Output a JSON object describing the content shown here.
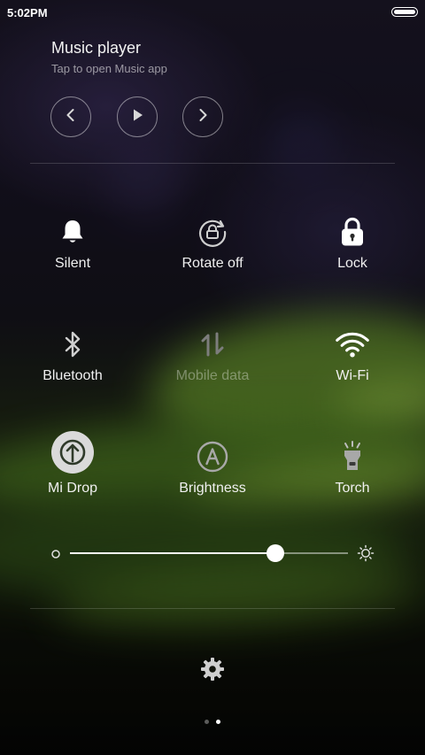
{
  "status_bar": {
    "time": "5:02PM",
    "battery_level": 1.0
  },
  "music": {
    "title": "Music player",
    "subtitle": "Tap to open Music app",
    "controls": {
      "prev_icon": "chevron-left-icon",
      "play_icon": "play-icon",
      "next_icon": "chevron-right-icon"
    }
  },
  "toggles": [
    {
      "label": "Silent",
      "icon": "bell-icon",
      "state": "on"
    },
    {
      "label": "Rotate off",
      "icon": "rotate-lock-icon",
      "state": "off"
    },
    {
      "label": "Lock",
      "icon": "lock-icon",
      "state": "on"
    },
    {
      "label": "Bluetooth",
      "icon": "bluetooth-icon",
      "state": "off"
    },
    {
      "label": "Mobile data",
      "icon": "mobile-data-icon",
      "state": "disabled"
    },
    {
      "label": "Wi-Fi",
      "icon": "wifi-icon",
      "state": "on"
    },
    {
      "label": "Mi Drop",
      "icon": "mi-drop-icon",
      "state": "on"
    },
    {
      "label": "Brightness",
      "icon": "auto-brightness-icon",
      "state": "off"
    },
    {
      "label": "Torch",
      "icon": "torch-icon",
      "state": "off"
    }
  ],
  "brightness": {
    "value": 0.74,
    "min_icon": "brightness-low-icon",
    "max_icon": "brightness-high-icon"
  },
  "settings": {
    "icon": "gear-icon"
  },
  "pagination": {
    "total": 2,
    "current": 2
  },
  "colors": {
    "active_icon": "#ffffff",
    "inactive_icon": "#cfcfcf",
    "disabled_icon": "#7d7d7d"
  }
}
